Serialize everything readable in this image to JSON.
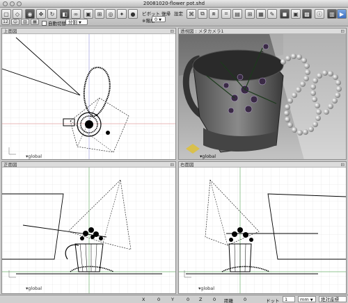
{
  "window": {
    "title": "20081020-flower pot.shd"
  },
  "toolbar": {
    "pivot_label": "ピボット",
    "restore_label": "復帰",
    "settings_label": "設定",
    "stage_label": "※階層",
    "stage_value": "0",
    "auto_switch_label": "自動切替",
    "split_value": "分割",
    "icons": [
      "window-icon",
      "shape-icon",
      "select-icon",
      "move-icon",
      "rotate-icon",
      "scale-icon",
      "link-icon",
      "image-icon",
      "ruler-icon",
      "camera-icon",
      "light-icon",
      "grid-icon",
      "table-icon",
      "render-icon",
      "display-icon"
    ]
  },
  "panes": {
    "top": {
      "label": "上面図",
      "global": "global"
    },
    "perspective": {
      "label": "透視図 : メタカメラ1",
      "global": "global"
    },
    "front": {
      "label": "正面図",
      "global": "global"
    },
    "right": {
      "label": "右面図",
      "global": "global"
    }
  },
  "statusbar": {
    "x_label": "X",
    "x_value": "0",
    "y_label": "Y",
    "y_value": "0",
    "z_label": "Z",
    "z_value": "0",
    "distance_label": "距離",
    "distance_value": "0",
    "dot_label": "ドット",
    "dot_value": "1",
    "unit_value": "mm",
    "coord_value": "絶対座標"
  }
}
